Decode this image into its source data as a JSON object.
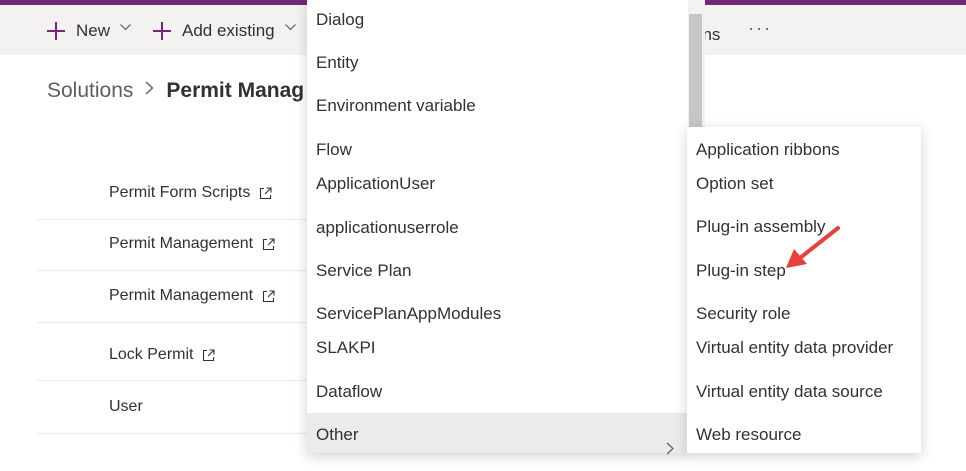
{
  "command_bar": {
    "new_label": "New",
    "add_existing_label": "Add existing",
    "options_label": "ons",
    "more_label": "···"
  },
  "breadcrumb": {
    "root": "Solutions",
    "separator": ">",
    "current": "Permit Manag"
  },
  "rows": [
    {
      "label": "Permit Form Scripts"
    },
    {
      "label": "Permit Management"
    },
    {
      "label": "Permit Management"
    },
    {
      "label": "Lock Permit"
    },
    {
      "label": "User"
    }
  ],
  "menu": {
    "items": [
      "Dialog",
      "Entity",
      "Environment variable",
      "Flow",
      "ApplicationUser",
      "applicationuserrole",
      "Service Plan",
      "ServicePlanAppModules",
      "SLAKPI",
      "Dataflow",
      "Other"
    ],
    "active_item": "Other"
  },
  "submenu": {
    "items": [
      "Application ribbons",
      "Option set",
      "Plug-in assembly",
      "Plug-in step",
      "Security role",
      "Virtual entity data provider",
      "Virtual entity data source",
      "Web resource"
    ]
  },
  "colors": {
    "brand": "#742774",
    "annotation_arrow": "#e8403a"
  },
  "icons": {
    "plus": "plus-icon",
    "chevron": "chevron-down-icon",
    "external": "open-in-new-window-icon",
    "submenu": "chevron-right-icon"
  }
}
